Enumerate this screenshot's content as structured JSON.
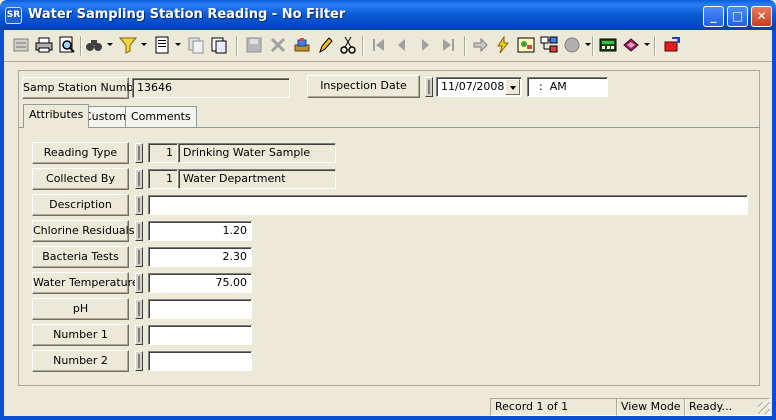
{
  "window": {
    "title": "Water Sampling Station Reading - No Filter",
    "app_icon": "SR",
    "controls": {
      "minimize": "_",
      "maximize": "□",
      "close": "✕"
    }
  },
  "toolbar": {
    "icons": [
      "form-icon",
      "print-icon",
      "print-preview-icon",
      "find-icon",
      "filter-icon",
      "report-icon",
      "copy-icon",
      "save-icon",
      "delete-icon",
      "edit-icon",
      "cut-icon",
      "first-record-icon",
      "previous-record-icon",
      "next-record-icon",
      "last-record-icon",
      "go-icon",
      "lightning-icon",
      "map-icon",
      "hierarchy-icon",
      "globe-icon",
      "calculator-icon",
      "book-icon",
      "exit-icon"
    ]
  },
  "header": {
    "station_label": "Samp Station Number",
    "station_value": "13646",
    "inspection_label": "Inspection Date",
    "inspection_date": "11/07/2008",
    "time_value": "  :  AM"
  },
  "tabs": [
    {
      "label": "Attributes",
      "active": true
    },
    {
      "label": "Custom",
      "active": false
    },
    {
      "label": "Comments",
      "active": false
    }
  ],
  "fields": [
    {
      "label": "Reading Type",
      "code": "1",
      "value": "Drinking Water Sample"
    },
    {
      "label": "Collected By",
      "code": "1",
      "value": "Water Department"
    },
    {
      "label": "Description",
      "value": ""
    },
    {
      "label": "Chlorine Residuals",
      "value": "1.20"
    },
    {
      "label": "Bacteria Tests",
      "value": "2.30"
    },
    {
      "label": "Water Temperature",
      "value": "75.00"
    },
    {
      "label": "pH",
      "value": ""
    },
    {
      "label": "Number 1",
      "value": ""
    },
    {
      "label": "Number 2",
      "value": ""
    }
  ],
  "status": {
    "record": "Record 1 of 1",
    "mode": "View Mode",
    "state": "Ready..."
  }
}
